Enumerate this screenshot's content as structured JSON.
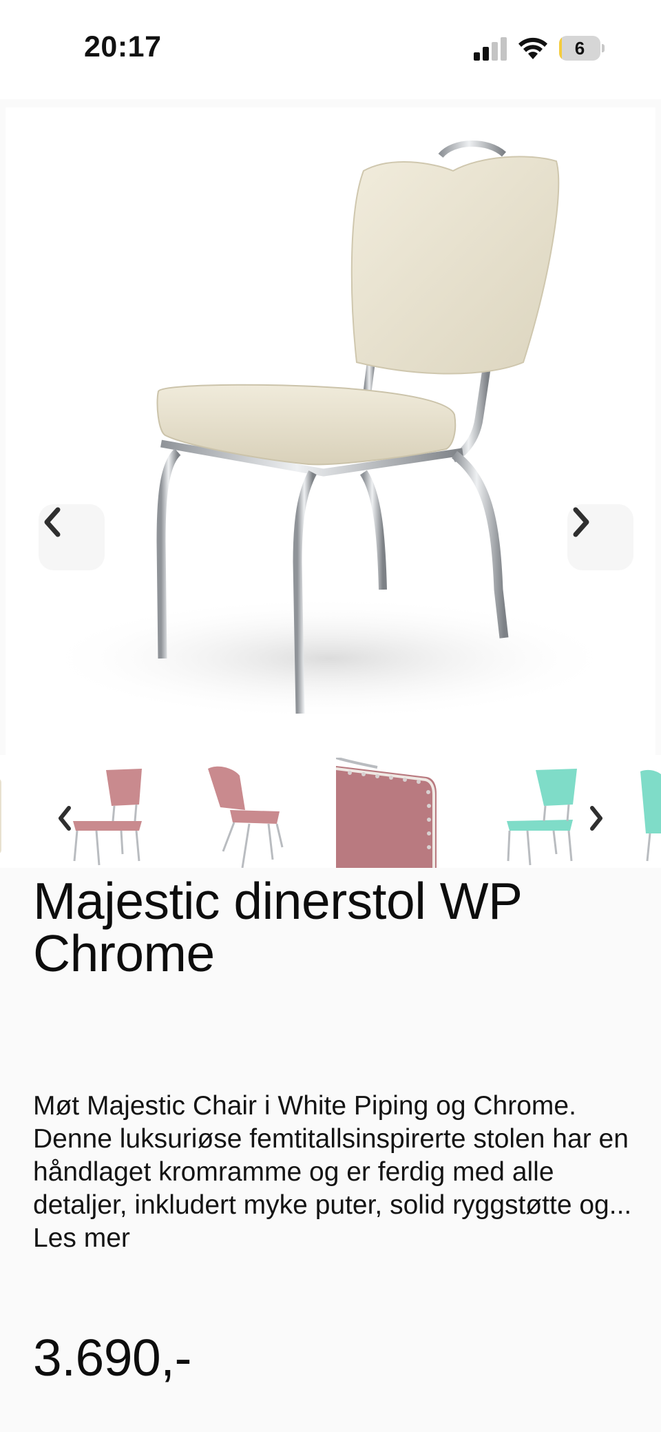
{
  "status_bar": {
    "time": "20:17",
    "battery_level": "6",
    "battery_fraction": 0.06,
    "signal_bars_active": 2,
    "icons": [
      "signal-icon",
      "wifi-icon",
      "battery-icon"
    ]
  },
  "gallery": {
    "main_image": "cream-diner-chair-image",
    "prev_icon": "chevron-left-icon",
    "next_icon": "chevron-right-icon",
    "thumbnails": [
      {
        "name": "thumbnail-cream-partial",
        "color": "#e8e1cf"
      },
      {
        "name": "thumbnail-pink-chair-front",
        "color": "#c98a8e"
      },
      {
        "name": "thumbnail-pink-chair-side",
        "color": "#c98a8e"
      },
      {
        "name": "thumbnail-pink-seat-detail",
        "color": "#b97a80"
      },
      {
        "name": "thumbnail-turquoise-chair",
        "color": "#7fdcc8"
      },
      {
        "name": "thumbnail-turquoise-partial",
        "color": "#7fdcc8"
      }
    ]
  },
  "product": {
    "title_line1": "Majestic dinerstol WP",
    "title_line2": "Chrome",
    "description": "Møt Majestic Chair i White Piping og Chrome. Denne luksuriøse femtitallsinspirerte stolen har en håndlaget kromramme og er ferdig med alle detaljer, inkludert myke puter, solid ryggstøtte og...",
    "read_more": "Les mer",
    "price": "3.690,-"
  },
  "colors": {
    "upholstery_cream": "#ece6d4",
    "chrome": "#b9bcc0",
    "pink": "#c98a8e",
    "turquoise": "#7fdcc8",
    "background": "#fafafa"
  }
}
